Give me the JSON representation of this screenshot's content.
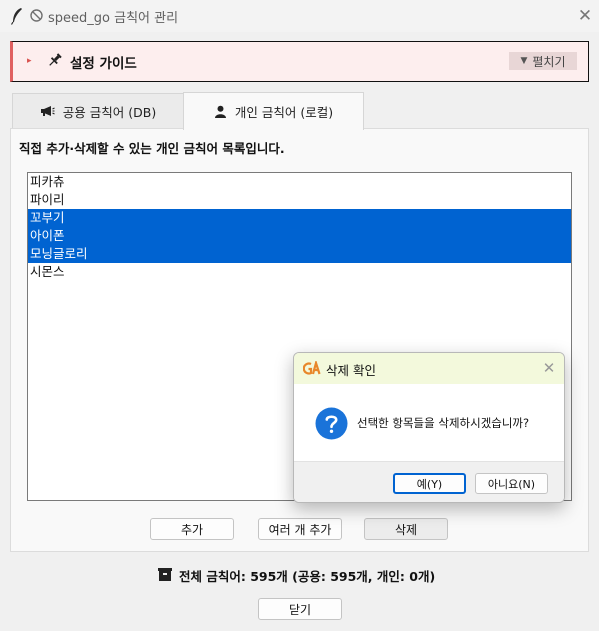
{
  "window": {
    "title": "speed_go 금칙어 관리",
    "close_symbol": "✕"
  },
  "guide": {
    "arrow": "▸",
    "title": "설정 가이드",
    "expand_label": "펼치기",
    "expand_arrow": "▼"
  },
  "tabs": [
    {
      "label": "공용 금칙어 (DB)",
      "icon": "megaphone-icon",
      "selected": false
    },
    {
      "label": "개인 금칙어 (로컬)",
      "icon": "user-icon",
      "selected": true
    }
  ],
  "panel": {
    "description": "직접 추가·삭제할 수 있는 개인 금칙어 목록입니다.",
    "items": [
      {
        "label": "피카츄",
        "selected": false
      },
      {
        "label": "파이리",
        "selected": false
      },
      {
        "label": "꼬부기",
        "selected": true
      },
      {
        "label": "아이폰",
        "selected": true
      },
      {
        "label": "모닝글로리",
        "selected": true
      },
      {
        "label": "시몬스",
        "selected": false
      }
    ],
    "buttons": {
      "add": "추가",
      "multi_add": "여러 개 추가",
      "delete": "삭제"
    }
  },
  "footer": {
    "total": "전체 금칙어: 595개 (공용: 595개, 개인: 0개)",
    "close_label": "닫기"
  },
  "dialog": {
    "title": "삭제 확인",
    "message": "선택한 항목들을 삭제하시겠습니까?",
    "yes_label": "예(Y)",
    "no_label": "아니요(N)",
    "close_symbol": "✕"
  },
  "colors": {
    "selection": "#0063d1",
    "guide_accent": "#e06060",
    "question_icon": "#1a73d9"
  }
}
